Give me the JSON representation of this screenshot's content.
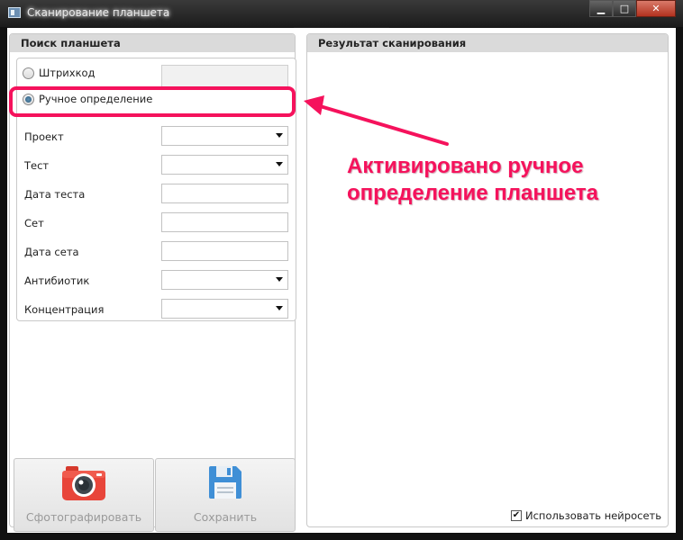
{
  "window": {
    "title": "Сканирование планшета",
    "minimize_glyph": "▁",
    "maximize_glyph": "□",
    "close_glyph": "✕"
  },
  "left_panel": {
    "title": "Поиск планшета",
    "barcode_label": "Штрихкод",
    "manual_label": "Ручное определение",
    "manual_selected": true,
    "fields": [
      {
        "label": "Проект",
        "type": "select",
        "value": ""
      },
      {
        "label": "Тест",
        "type": "select",
        "value": ""
      },
      {
        "label": "Дата теста",
        "type": "text",
        "value": ""
      },
      {
        "label": "Сет",
        "type": "text",
        "value": ""
      },
      {
        "label": "Дата сета",
        "type": "text",
        "value": ""
      },
      {
        "label": "Антибиотик",
        "type": "select",
        "value": ""
      },
      {
        "label": "Концентрация",
        "type": "select",
        "value": ""
      }
    ],
    "photo_button": {
      "label": "Сфотографировать",
      "icon": "camera-icon"
    },
    "save_button": {
      "label": "Сохранить",
      "icon": "floppy-disk-icon"
    }
  },
  "right_panel": {
    "title": "Результат сканирования",
    "neural_checkbox_label": "Использовать нейросеть",
    "neural_checked": true
  },
  "annotation": {
    "line1": "Активировано ручное",
    "line2": "определение планшета",
    "color": "#f5125c"
  }
}
